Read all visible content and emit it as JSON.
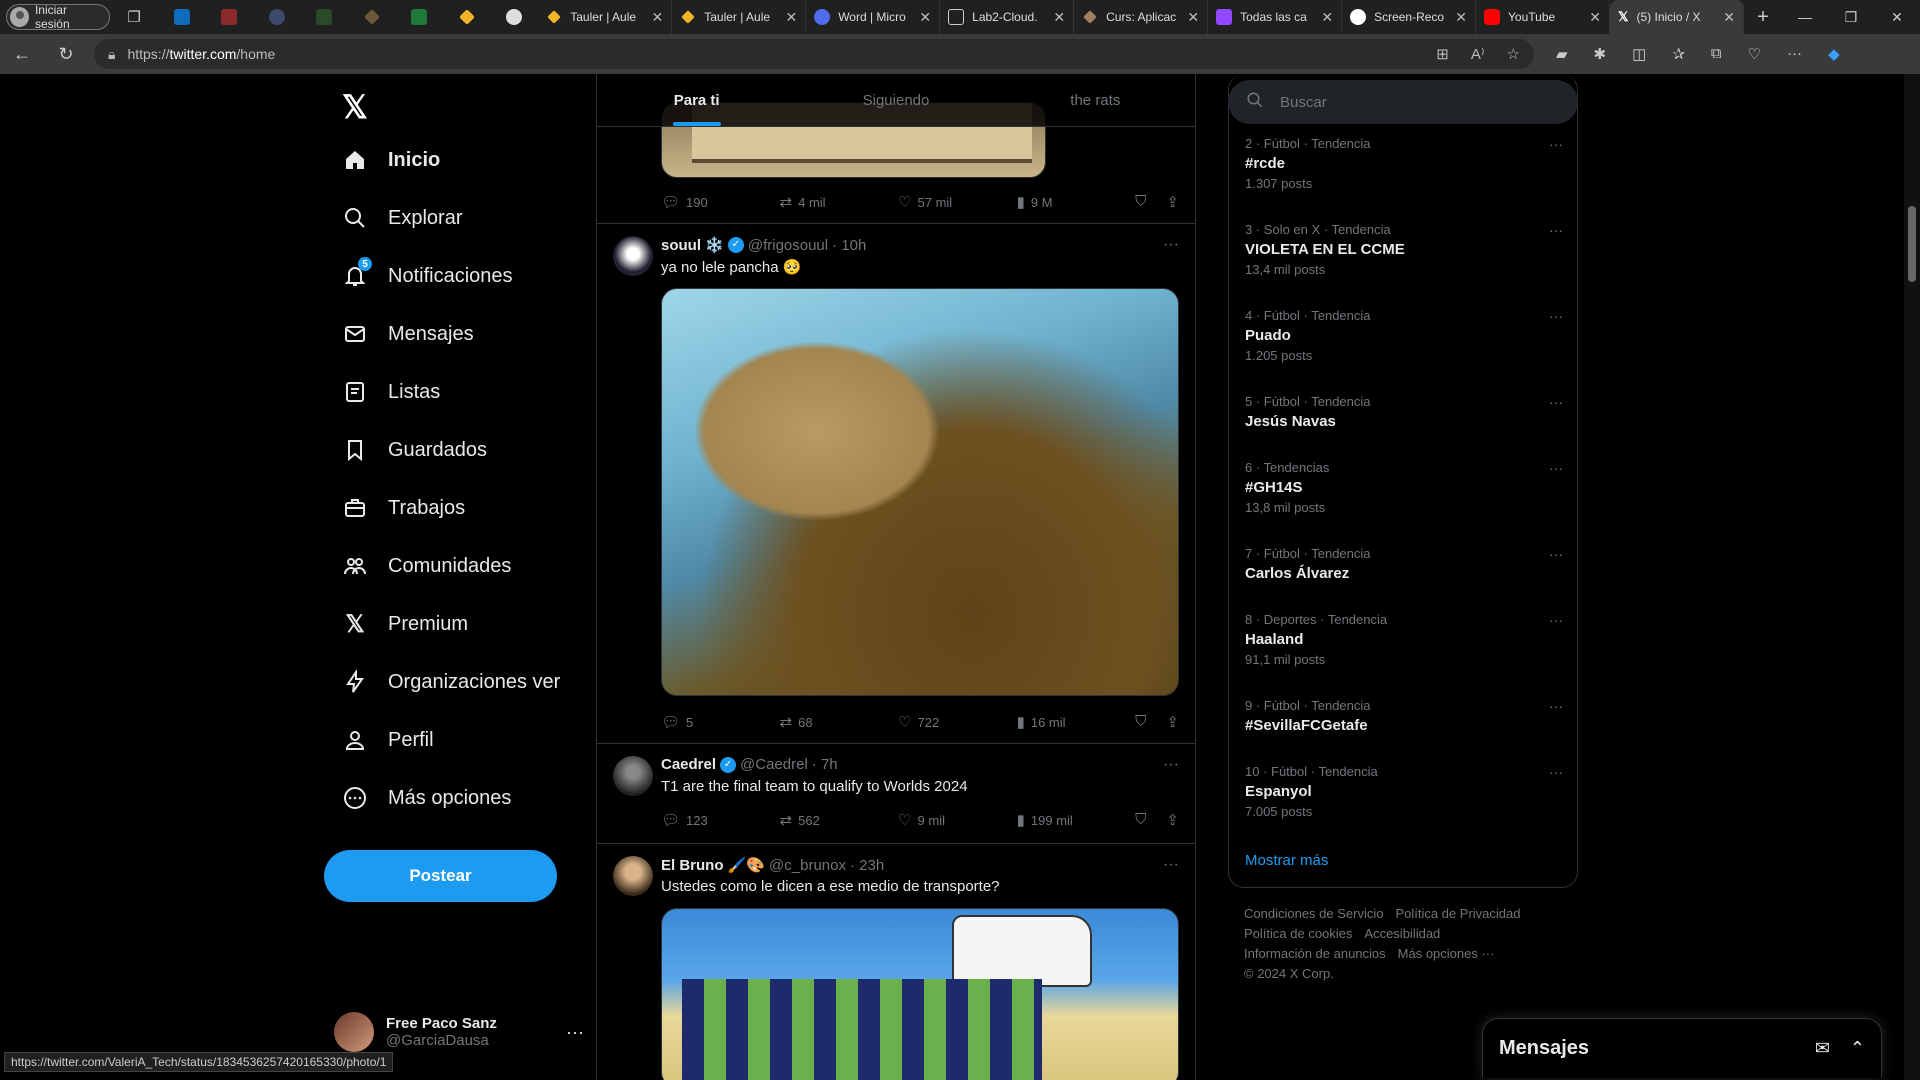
{
  "browser": {
    "profile_label": "Iniciar sesión",
    "tabs": [
      {
        "label": "Tauler | Aule",
        "color": "#f0b429"
      },
      {
        "label": "Tauler | Aule",
        "color": "#f0b429"
      },
      {
        "label": "Word | Micro",
        "color": "#4f6bed"
      },
      {
        "label": "Lab2-Cloud.",
        "color": "#cccccc"
      },
      {
        "label": "Curs: Aplicac",
        "color": "#a08060"
      },
      {
        "label": "Todas las ca",
        "color": "#9146ff"
      },
      {
        "label": "Screen-Reco",
        "color": "#ffffff"
      },
      {
        "label": "YouTube",
        "color": "#ff0000"
      },
      {
        "label": "(5) Inicio / X",
        "color": "#ffffff"
      }
    ],
    "url_scheme": "https://",
    "url_host": "twitter.com",
    "url_path": "/home",
    "status_url": "https://twitter.com/ValeriA_Tech/status/1834536257420165330/photo/1"
  },
  "nav": {
    "items": [
      {
        "label": "Inicio",
        "icon": "home-icon"
      },
      {
        "label": "Explorar",
        "icon": "search-icon"
      },
      {
        "label": "Notificaciones",
        "icon": "bell-icon",
        "badge": "5"
      },
      {
        "label": "Mensajes",
        "icon": "mail-icon"
      },
      {
        "label": "Listas",
        "icon": "list-icon"
      },
      {
        "label": "Guardados",
        "icon": "bookmark-icon"
      },
      {
        "label": "Trabajos",
        "icon": "briefcase-icon"
      },
      {
        "label": "Comunidades",
        "icon": "people-icon"
      },
      {
        "label": "Premium",
        "icon": "x-icon"
      },
      {
        "label": "Organizaciones ver",
        "icon": "lightning-icon"
      },
      {
        "label": "Perfil",
        "icon": "person-icon"
      },
      {
        "label": "Más opciones",
        "icon": "more-circle-icon"
      }
    ],
    "post_button": "Postear",
    "account": {
      "name": "Free Paco Sanz",
      "handle": "@GarciaDausa"
    }
  },
  "feed": {
    "tabs": [
      "Para ti",
      "Siguiendo",
      "the rats"
    ],
    "top_post_actions": {
      "replies": "190",
      "reposts": "4 mil",
      "likes": "57 mil",
      "views": "9 M"
    },
    "posts": [
      {
        "name": "souul ❄️",
        "handle": "@frigosouul",
        "time": "· 10h",
        "text": "ya no lele pancha 🥺",
        "replies": "5",
        "reposts": "68",
        "likes": "722",
        "views": "16 mil"
      },
      {
        "name": "Caedrel",
        "handle": "@Caedrel",
        "time": "· 7h",
        "text": "T1 are the final team to qualify to Worlds 2024",
        "replies": "123",
        "reposts": "562",
        "likes": "9 mil",
        "views": "199 mil"
      },
      {
        "name": "El Bruno 🖌️🎨",
        "handle": "@c_brunox",
        "time": "· 23h",
        "text": "Ustedes como le dicen a ese medio de transporte?"
      }
    ]
  },
  "sidebar": {
    "search_placeholder": "Buscar",
    "trends": [
      {
        "meta": "2 · Fútbol · Tendencia",
        "topic": "#rcde",
        "count": "1.307 posts"
      },
      {
        "meta": "3 · Solo en X · Tendencia",
        "topic": "VIOLETA EN EL CCME",
        "count": "13,4 mil posts"
      },
      {
        "meta": "4 · Fútbol · Tendencia",
        "topic": "Puado",
        "count": "1.205 posts"
      },
      {
        "meta": "5 · Fútbol · Tendencia",
        "topic": "Jesús Navas",
        "count": ""
      },
      {
        "meta": "6 · Tendencias",
        "topic": "#GH14S",
        "count": "13,8 mil posts"
      },
      {
        "meta": "7 · Fútbol · Tendencia",
        "topic": "Carlos Álvarez",
        "count": ""
      },
      {
        "meta": "8 · Deportes · Tendencia",
        "topic": "Haaland",
        "count": "91,1 mil posts"
      },
      {
        "meta": "9 · Fútbol · Tendencia",
        "topic": "#SevillaFCGetafe",
        "count": ""
      },
      {
        "meta": "10 · Fútbol · Tendencia",
        "topic": "Espanyol",
        "count": "7.005 posts"
      }
    ],
    "show_more": "Mostrar más",
    "footer": [
      "Condiciones de Servicio",
      "Política de Privacidad",
      "Política de cookies",
      "Accesibilidad",
      "Información de anuncios",
      "Más opciones ···",
      "© 2024 X Corp."
    ],
    "messages_title": "Mensajes"
  }
}
